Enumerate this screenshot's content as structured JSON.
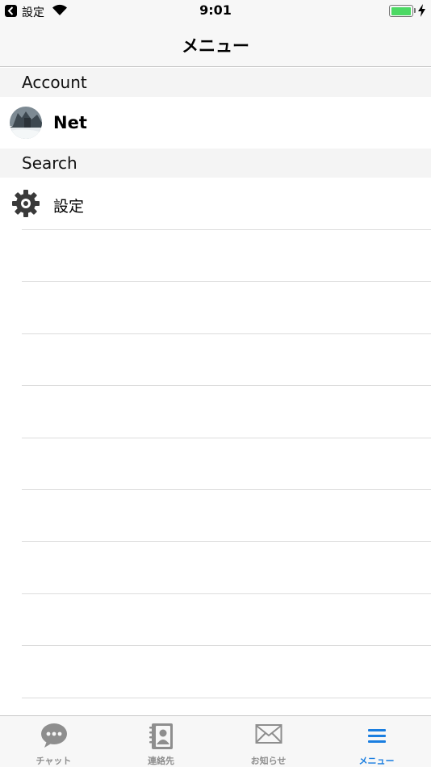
{
  "status_bar": {
    "back_label": "設定",
    "time": "9:01",
    "battery_level": 1.0
  },
  "nav": {
    "title": "メニュー"
  },
  "sections": [
    {
      "header": "Account",
      "row_label": "Net",
      "icon": "avatar"
    },
    {
      "header": "Search",
      "row_label": "設定",
      "icon": "gear-icon"
    }
  ],
  "tabs": [
    {
      "label": "チャット",
      "icon": "chat-bubble-icon",
      "active": false
    },
    {
      "label": "連絡先",
      "icon": "contacts-book-icon",
      "active": false
    },
    {
      "label": "お知らせ",
      "icon": "envelope-icon",
      "active": false
    },
    {
      "label": "メニュー",
      "icon": "menu-icon",
      "active": true
    }
  ],
  "colors": {
    "accent": "#1a7ee0",
    "tab_inactive": "#8e8e8e",
    "battery": "#4cd964"
  }
}
